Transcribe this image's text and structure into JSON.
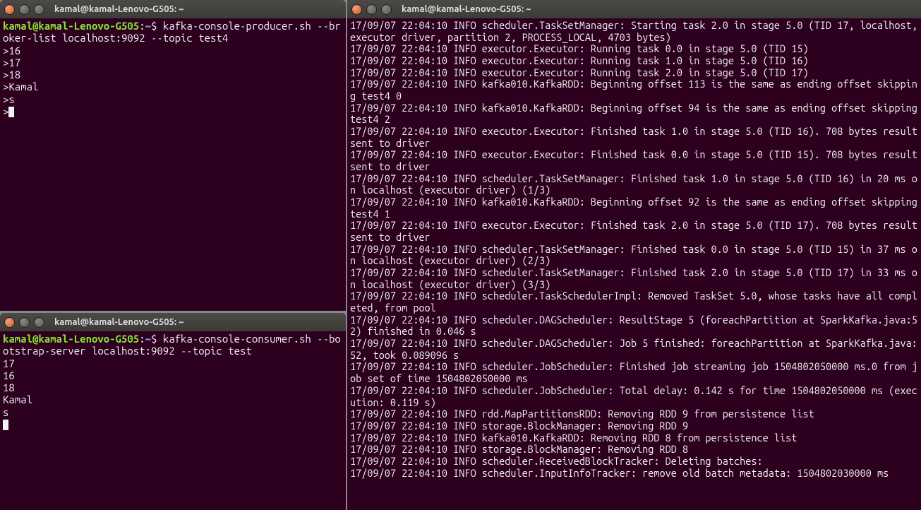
{
  "term1": {
    "title": "kamal@kamal-Lenovo-G505: ~",
    "prompt_user": "kamal@kamal-Lenovo-G505",
    "prompt_path": "~",
    "command": "kafka-console-producer.sh --broker-list localhost:9092 --topic test4",
    "lines": [
      ">16",
      ">17",
      ">18",
      ">Kamal",
      ">s",
      ">"
    ]
  },
  "term2": {
    "title": "kamal@kamal-Lenovo-G505: ~",
    "prompt_user": "kamal@kamal-Lenovo-G505",
    "prompt_path": "~",
    "command": "kafka-console-consumer.sh --bootstrap-server localhost:9092 --topic test",
    "lines": [
      "17",
      "16",
      "18",
      "Kamal",
      "s"
    ]
  },
  "term3": {
    "title": "kamal@kamal-Lenovo-G505: ~",
    "lines": [
      "17/09/07 22:04:10 INFO scheduler.TaskSetManager: Starting task 2.0 in stage 5.0 (TID 17, localhost, executor driver, partition 2, PROCESS_LOCAL, 4703 bytes)",
      "17/09/07 22:04:10 INFO executor.Executor: Running task 0.0 in stage 5.0 (TID 15)",
      "17/09/07 22:04:10 INFO executor.Executor: Running task 1.0 in stage 5.0 (TID 16)",
      "17/09/07 22:04:10 INFO executor.Executor: Running task 2.0 in stage 5.0 (TID 17)",
      "17/09/07 22:04:10 INFO kafka010.KafkaRDD: Beginning offset 113 is the same as ending offset skipping test4 0",
      "17/09/07 22:04:10 INFO kafka010.KafkaRDD: Beginning offset 94 is the same as ending offset skipping test4 2",
      "17/09/07 22:04:10 INFO executor.Executor: Finished task 1.0 in stage 5.0 (TID 16). 708 bytes result sent to driver",
      "17/09/07 22:04:10 INFO executor.Executor: Finished task 0.0 in stage 5.0 (TID 15). 708 bytes result sent to driver",
      "17/09/07 22:04:10 INFO scheduler.TaskSetManager: Finished task 1.0 in stage 5.0 (TID 16) in 20 ms on localhost (executor driver) (1/3)",
      "17/09/07 22:04:10 INFO kafka010.KafkaRDD: Beginning offset 92 is the same as ending offset skipping test4 1",
      "17/09/07 22:04:10 INFO executor.Executor: Finished task 2.0 in stage 5.0 (TID 17). 708 bytes result sent to driver",
      "17/09/07 22:04:10 INFO scheduler.TaskSetManager: Finished task 0.0 in stage 5.0 (TID 15) in 37 ms on localhost (executor driver) (2/3)",
      "17/09/07 22:04:10 INFO scheduler.TaskSetManager: Finished task 2.0 in stage 5.0 (TID 17) in 33 ms on localhost (executor driver) (3/3)",
      "17/09/07 22:04:10 INFO scheduler.TaskSchedulerImpl: Removed TaskSet 5.0, whose tasks have all completed, from pool",
      "17/09/07 22:04:10 INFO scheduler.DAGScheduler: ResultStage 5 (foreachPartition at SparkKafka.java:52) finished in 0.046 s",
      "17/09/07 22:04:10 INFO scheduler.DAGScheduler: Job 5 finished: foreachPartition at SparkKafka.java:52, took 0.089096 s",
      "17/09/07 22:04:10 INFO scheduler.JobScheduler: Finished job streaming job 1504802050000 ms.0 from job set of time 1504802050000 ms",
      "17/09/07 22:04:10 INFO scheduler.JobScheduler: Total delay: 0.142 s for time 1504802050000 ms (execution: 0.119 s)",
      "17/09/07 22:04:10 INFO rdd.MapPartitionsRDD: Removing RDD 9 from persistence list",
      "17/09/07 22:04:10 INFO storage.BlockManager: Removing RDD 9",
      "17/09/07 22:04:10 INFO kafka010.KafkaRDD: Removing RDD 8 from persistence list",
      "17/09/07 22:04:10 INFO storage.BlockManager: Removing RDD 8",
      "17/09/07 22:04:10 INFO scheduler.ReceivedBlockTracker: Deleting batches:",
      "17/09/07 22:04:10 INFO scheduler.InputInfoTracker: remove old batch metadata: 1504802030000 ms"
    ]
  }
}
